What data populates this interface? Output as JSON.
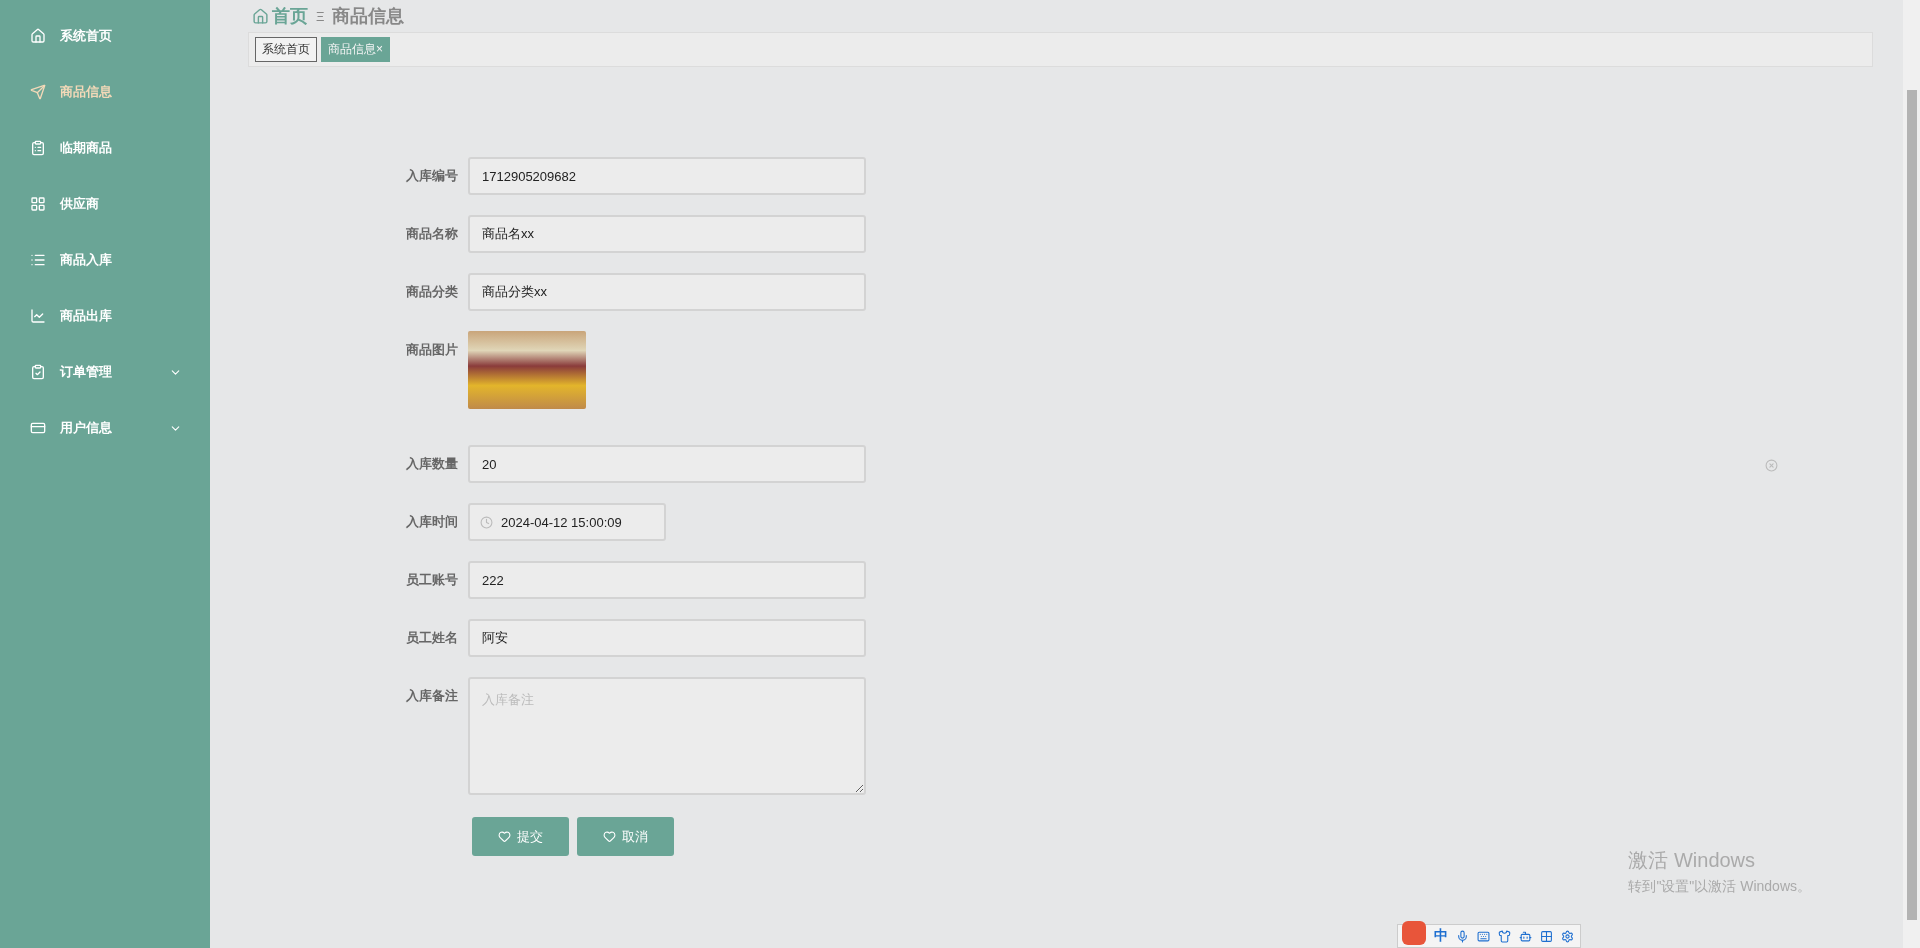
{
  "sidebar": {
    "items": [
      {
        "label": "系统首页",
        "selected": false,
        "expandable": false
      },
      {
        "label": "商品信息",
        "selected": true,
        "expandable": false
      },
      {
        "label": "临期商品",
        "selected": false,
        "expandable": false
      },
      {
        "label": "供应商",
        "selected": false,
        "expandable": false
      },
      {
        "label": "商品入库",
        "selected": false,
        "expandable": false
      },
      {
        "label": "商品出库",
        "selected": false,
        "expandable": false
      },
      {
        "label": "订单管理",
        "selected": false,
        "expandable": true
      },
      {
        "label": "用户信息",
        "selected": false,
        "expandable": true
      }
    ]
  },
  "breadcrumb": {
    "home": "首页",
    "separator": "Ξ",
    "current": "商品信息"
  },
  "tabs": [
    {
      "label": "系统首页",
      "selected": false
    },
    {
      "label": "商品信息",
      "selected": true,
      "close": "×"
    }
  ],
  "form": {
    "fields": [
      {
        "label": "入库编号",
        "kind": "text",
        "value": "1712905209682"
      },
      {
        "label": "商品名称",
        "kind": "text",
        "value": "商品名xx"
      },
      {
        "label": "商品分类",
        "kind": "text",
        "value": "商品分类xx"
      },
      {
        "label": "商品图片",
        "kind": "image"
      },
      {
        "label": "入库数量",
        "kind": "text",
        "value": "20"
      },
      {
        "label": "入库时间",
        "kind": "datetime",
        "value": "2024-04-12 15:00:09"
      },
      {
        "label": "员工账号",
        "kind": "text",
        "value": "222"
      },
      {
        "label": "员工姓名",
        "kind": "text",
        "value": "阿安"
      },
      {
        "label": "入库备注",
        "kind": "textarea",
        "placeholder": "入库备注"
      }
    ],
    "buttons": [
      "提交",
      "取消"
    ]
  },
  "activation": {
    "title": "激活 Windows",
    "hint": "转到\"设置\"以激活 Windows。"
  },
  "ime_bar": {
    "mode": "中"
  }
}
